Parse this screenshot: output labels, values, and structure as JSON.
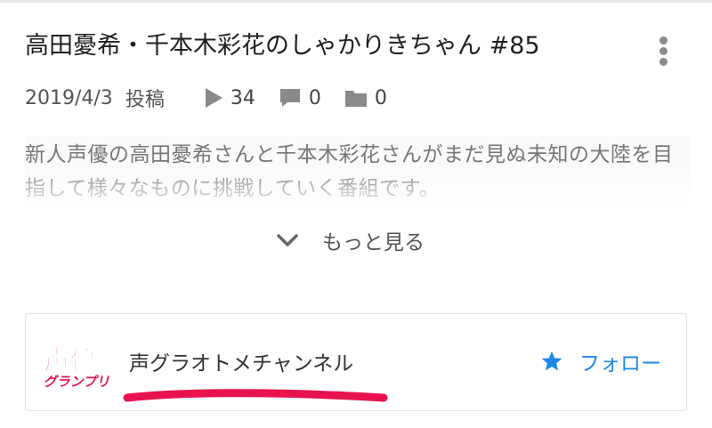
{
  "video": {
    "title": "高田憂希・千本木彩花のしゃかりきちゃん #85",
    "date": "2019/4/3",
    "posted_label": "投稿",
    "views": "34",
    "comments": "0",
    "mylists": "0",
    "description": "新人声優の高田憂希さんと千本木彩花さんがまだ見ぬ未知の大陸を目指して様々なものに挑戦していく番組です。",
    "expand_label": "もっと見る"
  },
  "channel": {
    "name": "声グラオトメチャンネル",
    "follow_label": "フォロー",
    "logo_text": "声優",
    "logo_sub_text": "グランプリ",
    "accent_color": "#1e88e5",
    "underline_color": "#e8124e"
  },
  "icons": {
    "play": "play-icon",
    "comment": "comment-icon",
    "folder": "folder-icon",
    "chevron": "chevron-down-icon",
    "star": "star-icon",
    "more": "kebab-menu-icon"
  }
}
